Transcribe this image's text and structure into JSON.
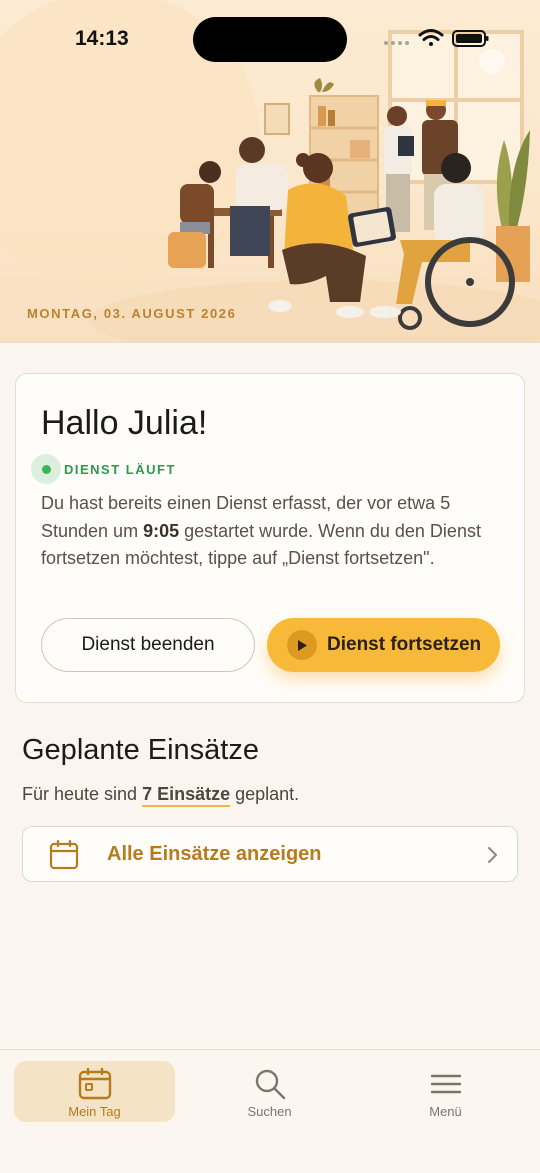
{
  "status_bar": {
    "time": "14:13"
  },
  "hero": {
    "date": "MONTAG, 03. AUGUST 2026"
  },
  "card": {
    "greeting": "Hallo Julia!",
    "status_label": "DIENST LÄUFT",
    "text_part1": "Du hast bereits einen Dienst erfasst, der vor etwa 5 Stunden um ",
    "start_time": "9:05",
    "text_part2": " gestartet wurde. Wenn du den Dienst fortsetzen möchtest, tippe auf „Dienst fortsetzen\".",
    "end_button": "Dienst beenden",
    "continue_button": "Dienst fortsetzen"
  },
  "planned": {
    "title": "Geplante Einsätze",
    "sub_prefix": "Für heute sind ",
    "count": "7 Einsätze",
    "sub_suffix": " geplant.",
    "all_label": "Alle Einsätze anzeigen"
  },
  "tabs": [
    {
      "label": "Mein Tag",
      "icon": "calendar-icon",
      "active": true
    },
    {
      "label": "Suchen",
      "icon": "search-icon",
      "active": false
    },
    {
      "label": "Menü",
      "icon": "menu-icon",
      "active": false
    }
  ],
  "colors": {
    "accent": "#f8b93a",
    "accent_text": "#b77b1d",
    "status_green": "#3db35a",
    "background": "#faf6ef"
  }
}
